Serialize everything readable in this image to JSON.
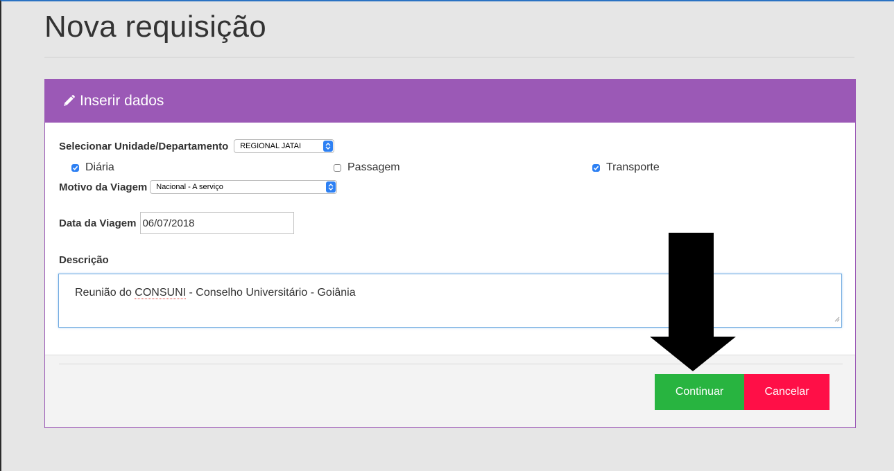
{
  "page": {
    "title": "Nova requisição"
  },
  "panel": {
    "heading": "Inserir dados",
    "heading_icon": "pencil-icon",
    "accent_color": "#9b59b6"
  },
  "form": {
    "unit_label": "Selecionar Unidade/Departamento",
    "unit_value": "REGIONAL JATAI",
    "checkboxes": [
      {
        "label": "Diária",
        "checked": true
      },
      {
        "label": "Passagem",
        "checked": false
      },
      {
        "label": "Transporte",
        "checked": true
      }
    ],
    "motivo_label": "Motivo da Viagem",
    "motivo_value": "Nacional - A serviço",
    "data_label": "Data da Viagem",
    "data_value": "06/07/2018",
    "descricao_label": "Descrição",
    "descricao_prefix": "Reunião do ",
    "descricao_misspelled": "CONSUNI",
    "descricao_suffix": " - Conselho Universitário - Goiânia"
  },
  "actions": {
    "continue_label": "Continuar",
    "continue_color": "#28b440",
    "cancel_label": "Cancelar",
    "cancel_color": "#ff0f47"
  },
  "annotation": {
    "icon": "down-arrow-icon"
  }
}
